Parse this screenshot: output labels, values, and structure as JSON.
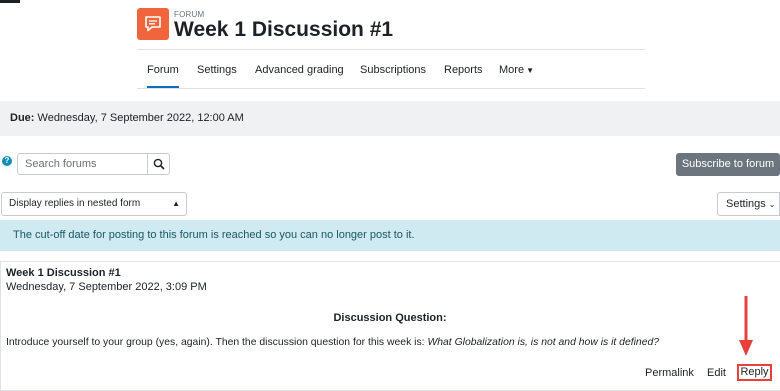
{
  "header": {
    "context_label": "FORUM",
    "title": "Week 1 Discussion #1"
  },
  "tabs": [
    {
      "label": "Forum",
      "active": true
    },
    {
      "label": "Settings"
    },
    {
      "label": "Advanced grading"
    },
    {
      "label": "Subscriptions"
    },
    {
      "label": "Reports"
    },
    {
      "label": "More",
      "has_dropdown": true
    }
  ],
  "due": {
    "label": "Due:",
    "value": "Wednesday, 7 September 2022, 12:00 AM"
  },
  "search": {
    "placeholder": "Search forums",
    "help_glyph": "?"
  },
  "subscribe_button": "Subscribe to forum",
  "display_mode": {
    "selected": "Display replies in nested form"
  },
  "settings_button": "Settings",
  "notice": "The cut-off date for posting to this forum is reached so you can no longer post to it.",
  "post": {
    "title": "Week 1 Discussion #1",
    "date": "Wednesday, 7 September 2022, 3:09 PM",
    "heading": "Discussion Question:",
    "body_plain": "Introduce yourself to your group (yes, again).  Then the discussion question for this week is: ",
    "body_italic": "What Globalization is, is not and how is it defined?"
  },
  "actions": {
    "permalink": "Permalink",
    "edit": "Edit",
    "reply": "Reply"
  },
  "colors": {
    "forum_icon": "#f0653c",
    "accent_blue": "#0f6cbf",
    "notice_bg": "#cfeaf0",
    "annotation_red": "#e8413c",
    "subscribe_bg": "#6c757d"
  }
}
